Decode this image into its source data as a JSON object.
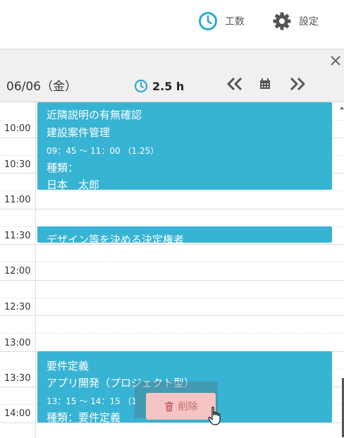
{
  "header": {
    "kosu_label": "工数",
    "settei_label": "設定"
  },
  "panel": {
    "date": "06/06（金）",
    "total_hours": "2.5 h"
  },
  "times": [
    "10:00",
    "10:30",
    "11:00",
    "11:30",
    "12:00",
    "12:30",
    "13:00",
    "13:30",
    "14:00"
  ],
  "events": [
    {
      "title": "近隣説明の有無確認",
      "project": "建設案件管理",
      "time": "09：45 ～ 11：00 （1.25）",
      "type": "種類：",
      "person": "日本　太郎"
    },
    {
      "title": "デザイン等を決める決定権者"
    },
    {
      "title": "要件定義",
      "project": "アプリ開発（プロジェクト型）",
      "time": "13：15 ～ 14：15 （1",
      "type": "種類：要件定義"
    }
  ],
  "context_menu": {
    "delete_label": "削除"
  },
  "colors": {
    "event": "#37b3d3",
    "accent": "#2da8cf",
    "delete_bg": "#f6c4c4"
  }
}
